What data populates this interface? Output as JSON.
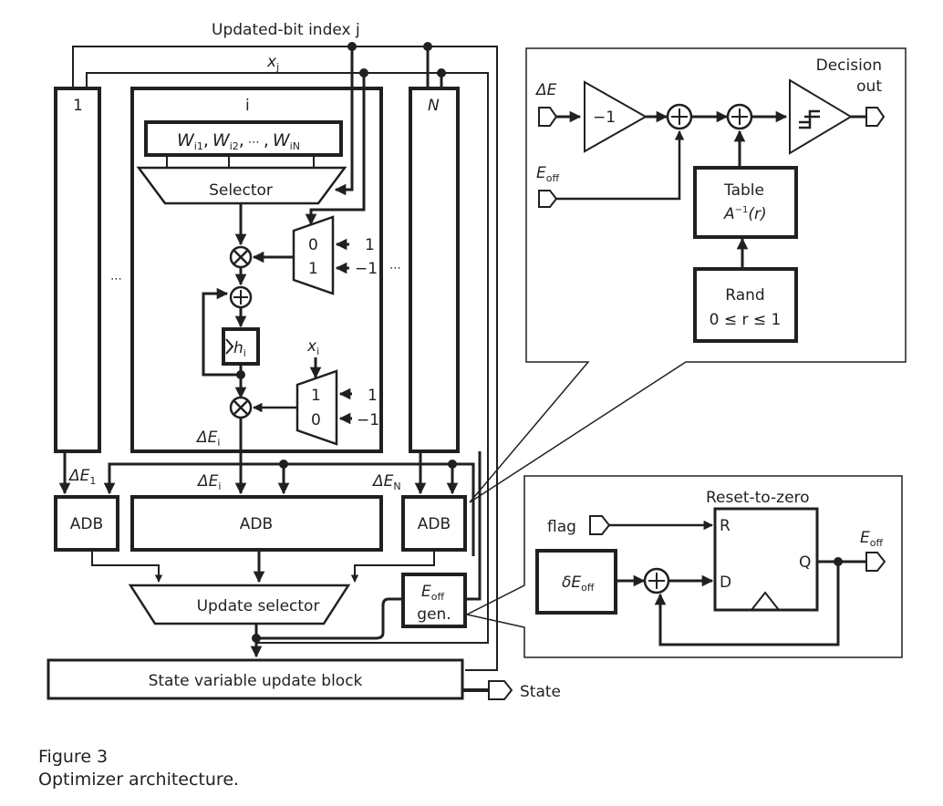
{
  "figure": {
    "number_label": "Figure 3",
    "caption": "Optimizer architecture."
  },
  "main": {
    "top_bus_label": "Updated-bit index j",
    "xj_label": "x",
    "xj_sub": "j",
    "column_first_label": "1",
    "column_i_label": "i",
    "column_last_label": "N",
    "ellipsis": "⋯",
    "weights": {
      "w": "W",
      "sub1": "i1",
      "sub2": "i2",
      "subN": "iN",
      "sep": ",",
      "dots": "⋯"
    },
    "selector_label": "Selector",
    "mux_top": {
      "in0": "0",
      "in1": "1",
      "val0": "1",
      "val1": "−1"
    },
    "mux_bottom": {
      "in0": "1",
      "in1": "0",
      "val0": "1",
      "val1": "−1",
      "select_label": "x",
      "select_sub": "i"
    },
    "h_register": {
      "label": "h",
      "sub": "i"
    },
    "delta_e_i": {
      "delta": "ΔE",
      "sub": "i"
    },
    "delta_e_1": {
      "delta": "ΔE",
      "sub": "1"
    },
    "delta_e_N": {
      "delta": "ΔE",
      "sub": "N"
    },
    "adb_label": "ADB",
    "update_selector_label": "Update selector",
    "eoff_gen": {
      "e": "E",
      "sub": "off",
      "gen": "gen."
    },
    "state_block_label": "State variable update block",
    "state_output_label": "State"
  },
  "adb_detail": {
    "input_delta_e": "ΔE",
    "input_eoff": {
      "e": "E",
      "sub": "off"
    },
    "gain_label": "−1",
    "table_label": "Table",
    "table_func": {
      "a": "A",
      "sup": "−1",
      "arg": "(r)"
    },
    "rand_label": "Rand",
    "rand_range": "0 ≤ r ≤ 1",
    "output_line1": "Decision",
    "output_line2": "out"
  },
  "eoff_detail": {
    "title": "Reset-to-zero",
    "flag_label": "flag",
    "delta_block": {
      "d": "δE",
      "sub": "off"
    },
    "port_r": "R",
    "port_d": "D",
    "port_q": "Q",
    "output": {
      "e": "E",
      "sub": "off"
    }
  },
  "colors": {
    "ink": "#231f20",
    "background": "#ffffff"
  }
}
